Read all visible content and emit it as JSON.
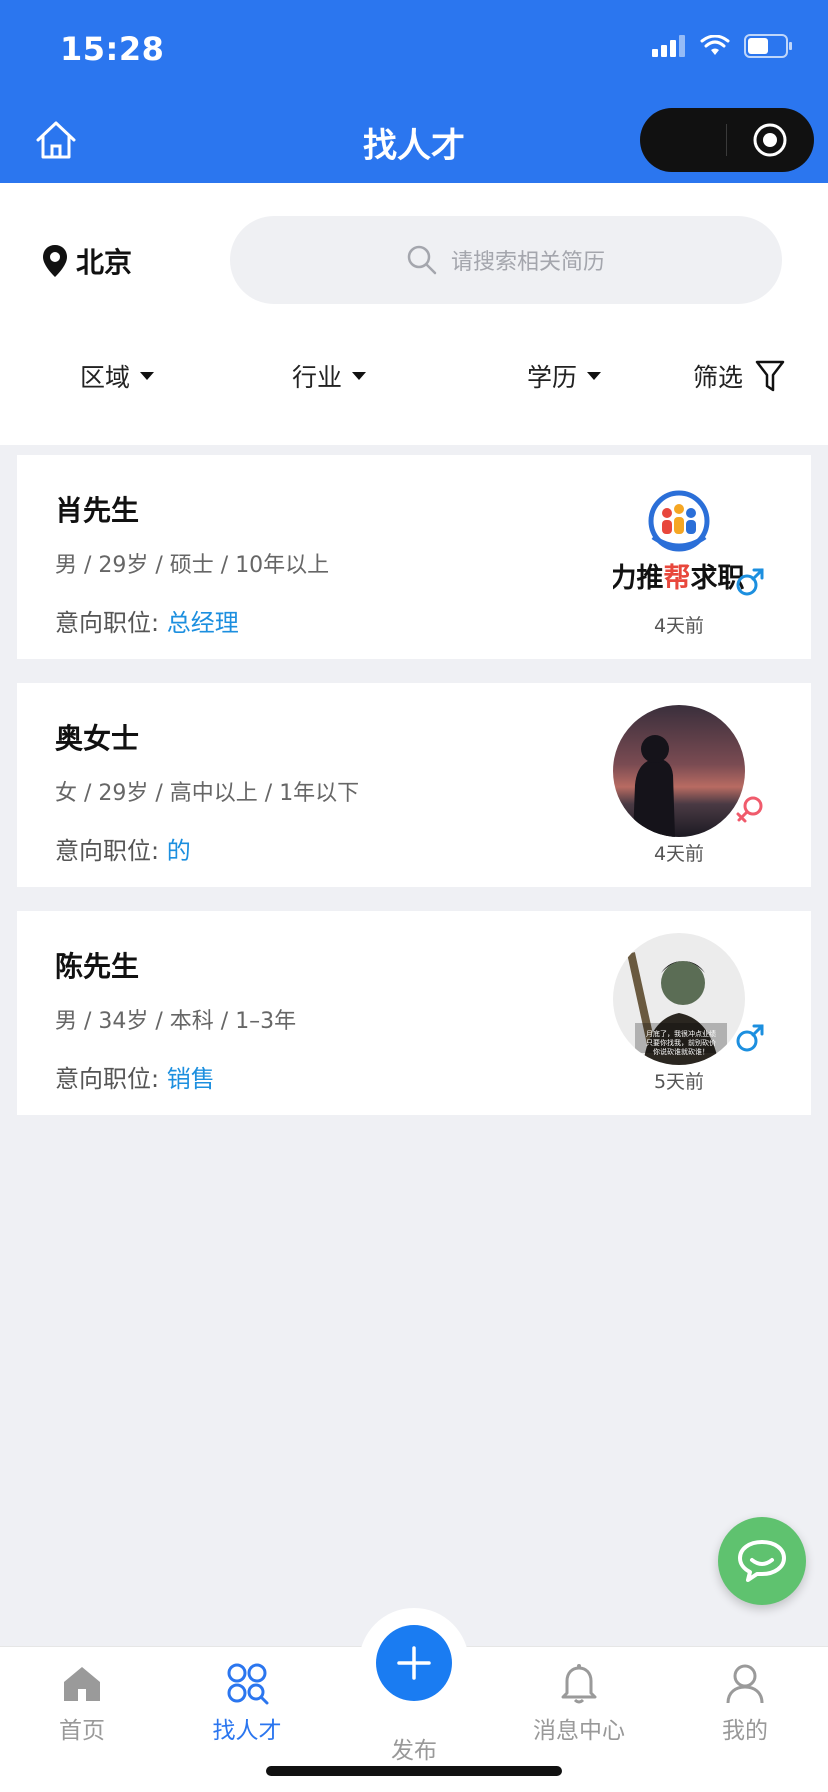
{
  "status_bar": {
    "time": "15:28"
  },
  "nav": {
    "title": "找人才"
  },
  "search": {
    "city": "北京",
    "placeholder": "请搜索相关简历"
  },
  "filters": [
    {
      "label": "区域"
    },
    {
      "label": "行业"
    },
    {
      "label": "学历"
    },
    {
      "label": "筛选"
    }
  ],
  "intent_label": "意向职位:",
  "candidates": [
    {
      "name": "肖先生",
      "info": "男 / 29岁 / 硕士 / 10年以上",
      "position": "总经理",
      "time": "4天前",
      "gender": "male",
      "avatar_text": "力推帮求职"
    },
    {
      "name": "奥女士",
      "info": "女 / 29岁 / 高中以上 / 1年以下",
      "position": "的",
      "time": "4天前",
      "gender": "female"
    },
    {
      "name": "陈先生",
      "info": "男 / 34岁 / 本科 / 1–3年",
      "position": "销售",
      "time": "5天前",
      "gender": "male",
      "avatar_text": "月底了，我很冲点业绩 只要你找我，前别砍价 你说砍谁就砍谁！"
    }
  ],
  "tabbar": {
    "home": "首页",
    "talent": "找人才",
    "publish": "发布",
    "messages": "消息中心",
    "mine": "我的"
  },
  "colors": {
    "brand": "#2b76ef",
    "link": "#1c8fdf",
    "male": "#1c8fdf",
    "female": "#f05b6c",
    "chat": "#5fc26f"
  }
}
